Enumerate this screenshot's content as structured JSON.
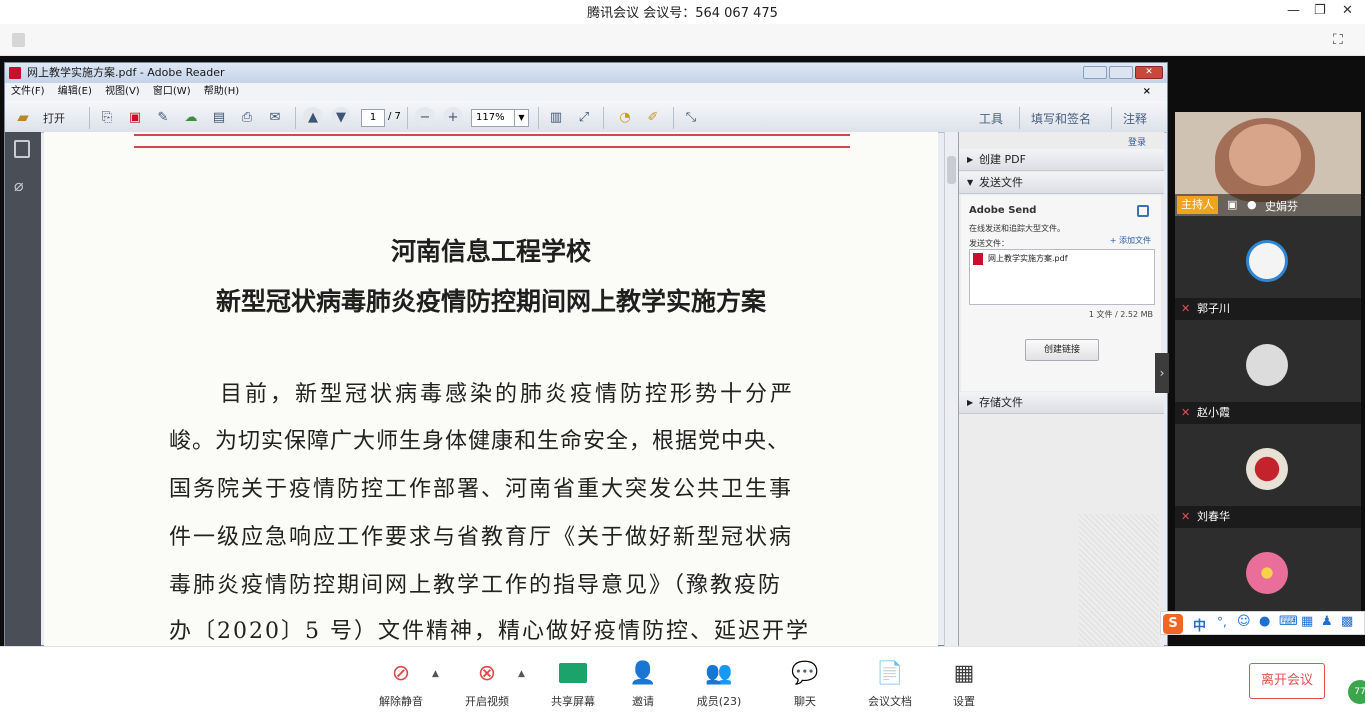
{
  "meeting": {
    "title": "腾讯会议 会议号：564 067 475",
    "leave_label": "离开会议",
    "toolbar": [
      {
        "label": "解除静音",
        "icon": "mic-muted-icon"
      },
      {
        "label": "开启视频",
        "icon": "video-off-icon"
      },
      {
        "label": "共享屏幕",
        "icon": "share-screen-icon"
      },
      {
        "label": "邀请",
        "icon": "invite-icon"
      },
      {
        "label": "成员(23)",
        "icon": "members-icon"
      },
      {
        "label": "聊天",
        "icon": "chat-icon"
      },
      {
        "label": "会议文档",
        "icon": "document-icon"
      },
      {
        "label": "设置",
        "icon": "settings-icon"
      }
    ],
    "participants": [
      {
        "name": "史娟芬",
        "role": "主持人"
      },
      {
        "name": "郭子川"
      },
      {
        "name": "赵小霞"
      },
      {
        "name": "刘春华"
      }
    ],
    "ime_label": "中",
    "corner_badge": "77"
  },
  "reader": {
    "window_title": "网上教学实施方案.pdf - Adobe Reader",
    "menu": [
      "文件(F)",
      "编辑(E)",
      "视图(V)",
      "窗口(W)",
      "帮助(H)"
    ],
    "open_label": "打开",
    "page_current": "1",
    "page_total": "/ 7",
    "zoom": "117%",
    "right_tabs": [
      "工具",
      "填写和签名",
      "注释"
    ],
    "login": "登录",
    "panel": {
      "create_pdf": "创建 PDF",
      "send_files": "发送文件",
      "adobe_send": "Adobe Send",
      "desc": "在线发送和追踪大型文件。",
      "send_files_label": "发送文件：",
      "add_files": "+ 添加文件",
      "file_name": "网上教学实施方案.pdf",
      "file_meta": "1 文件 / 2.52 MB",
      "create_link": "创建链接",
      "store_files": "存储文件"
    }
  },
  "document": {
    "title1": "河南信息工程学校",
    "title2": "新型冠状病毒肺炎疫情防控期间网上教学实施方案",
    "lines": [
      "目前，新型冠状病毒感染的肺炎疫情防控形势十分严",
      "峻。为切实保障广大师生身体健康和生命安全，根据党中央、",
      "国务院关于疫情防控工作部署、河南省重大突发公共卫生事",
      "件一级应急响应工作要求与省教育厅《关于做好新型冠状病",
      "毒肺炎疫情防控期间网上教学工作的指导意见》（豫教疫防",
      "办〔2020〕5 号）文件精神，精心做好疫情防控、延迟开学"
    ]
  }
}
